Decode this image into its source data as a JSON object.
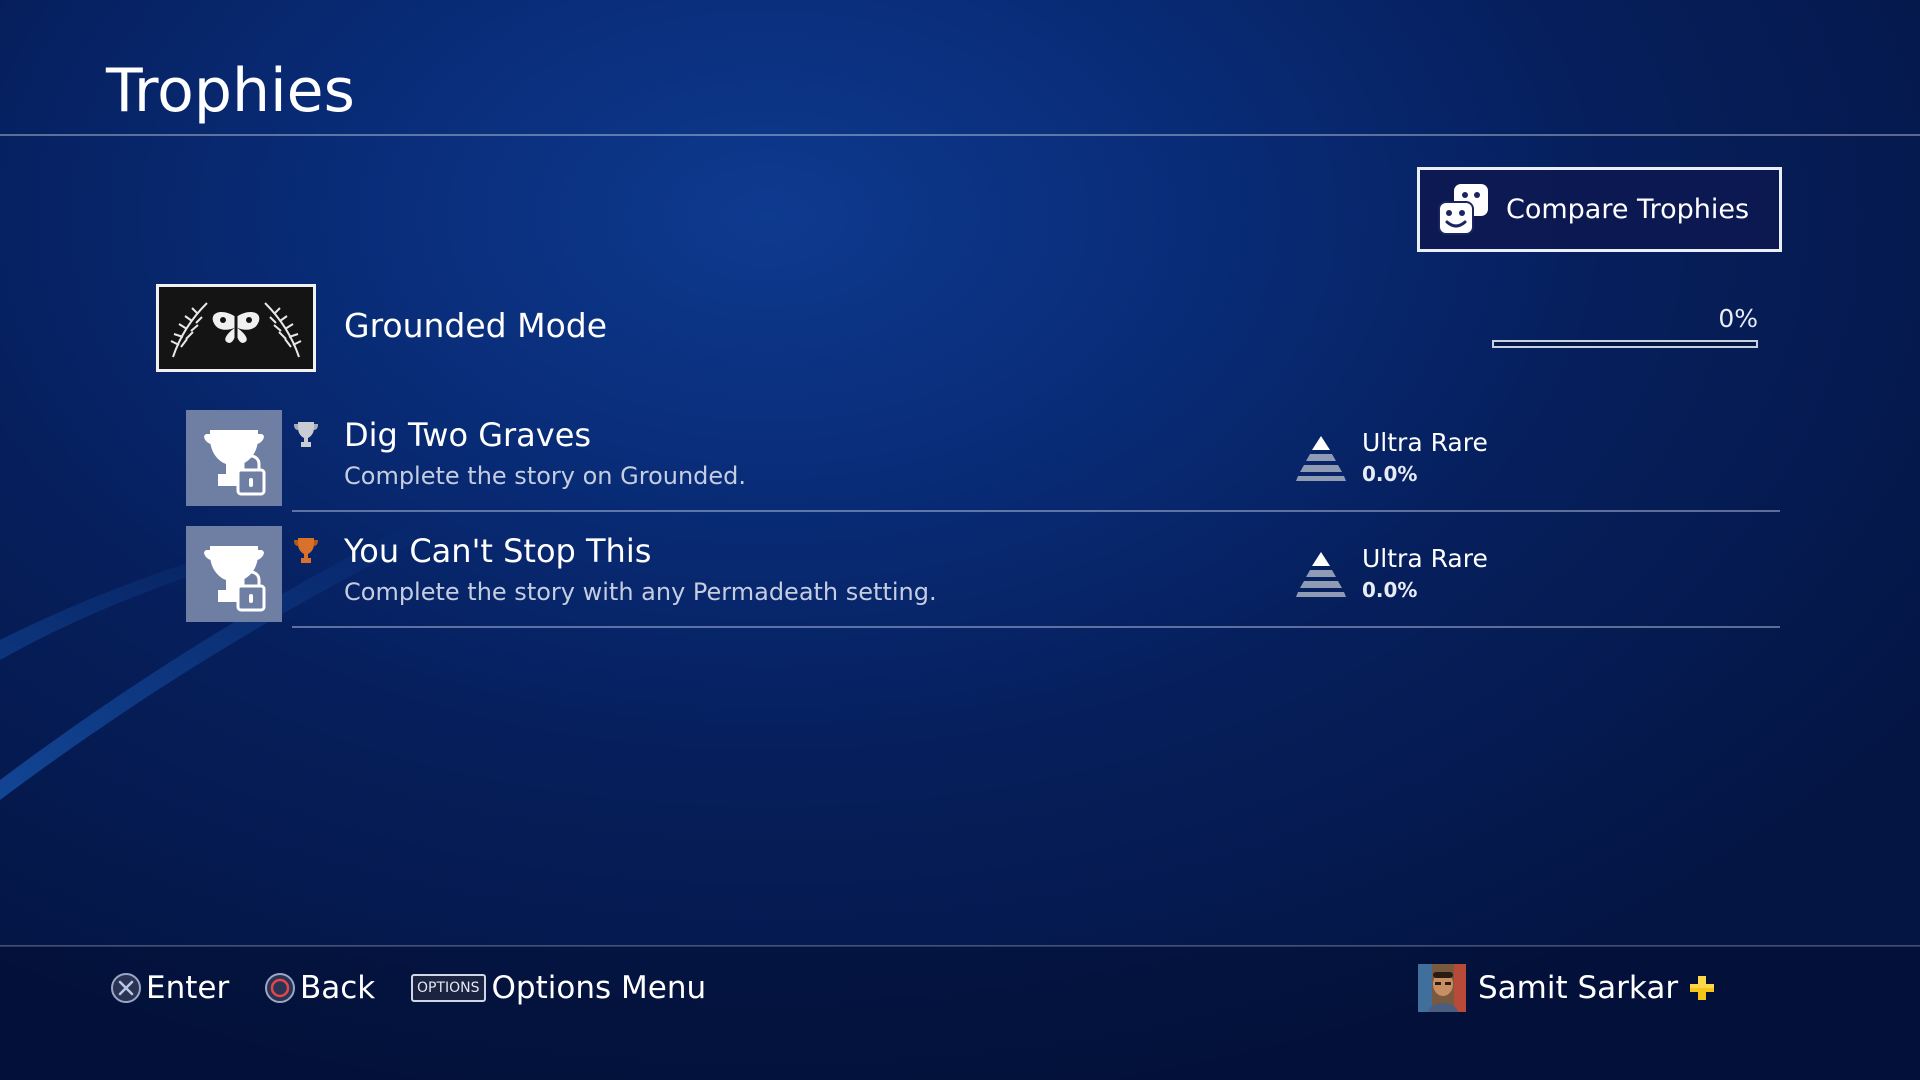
{
  "header": {
    "title": "Trophies"
  },
  "compare_button": {
    "label": "Compare Trophies",
    "icon": "faces-icon"
  },
  "group": {
    "name": "Grounded Mode",
    "progress_text": "0%",
    "progress": 0
  },
  "trophies": [
    {
      "name": "Dig Two Graves",
      "description": "Complete the story on Grounded.",
      "grade": "silver",
      "locked": true,
      "rarity_label": "Ultra Rare",
      "rarity_value": "0.0%"
    },
    {
      "name": "You Can't Stop This",
      "description": "Complete the story with any Permadeath setting.",
      "grade": "bronze",
      "locked": true,
      "rarity_label": "Ultra Rare",
      "rarity_value": "0.0%"
    }
  ],
  "footer": {
    "hints": [
      {
        "button": "cross",
        "label": "Enter"
      },
      {
        "button": "circle",
        "label": "Back"
      },
      {
        "button": "OPTIONS",
        "label": "Options Menu"
      }
    ],
    "user": {
      "name": "Samit Sarkar",
      "plus": true
    }
  },
  "colors": {
    "background": "#061f5c",
    "silver_trophy": "#c9ccd3",
    "bronze_trophy": "#c8641e",
    "plus_yellow": "#f5c518",
    "locked_thumb": "#6f7ea3"
  }
}
